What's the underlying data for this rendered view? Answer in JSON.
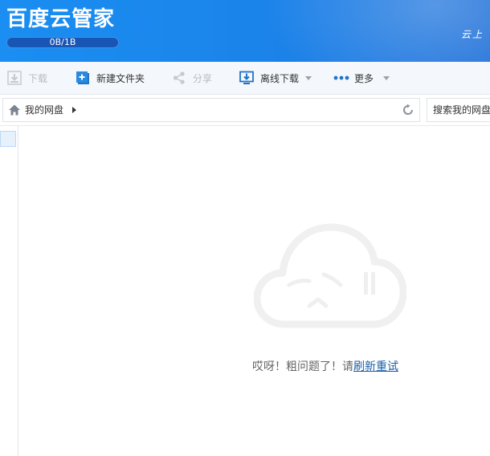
{
  "app": {
    "title": "百度云管家",
    "quota": "0B/1B",
    "slogan": "云上"
  },
  "toolbar": {
    "download": "下载",
    "new_folder": "新建文件夹",
    "share": "分享",
    "offline_download": "离线下载",
    "more": "更多"
  },
  "address": {
    "crumb": "我的网盘"
  },
  "search": {
    "placeholder": "搜索我的网盘"
  },
  "content": {
    "error_text": "哎呀！粗问题了！请",
    "retry_link": "刷新重试"
  },
  "colors": {
    "header": "#1b86ee",
    "link": "#1b5fa8",
    "toolbar_bg": "#f4f7fb"
  }
}
